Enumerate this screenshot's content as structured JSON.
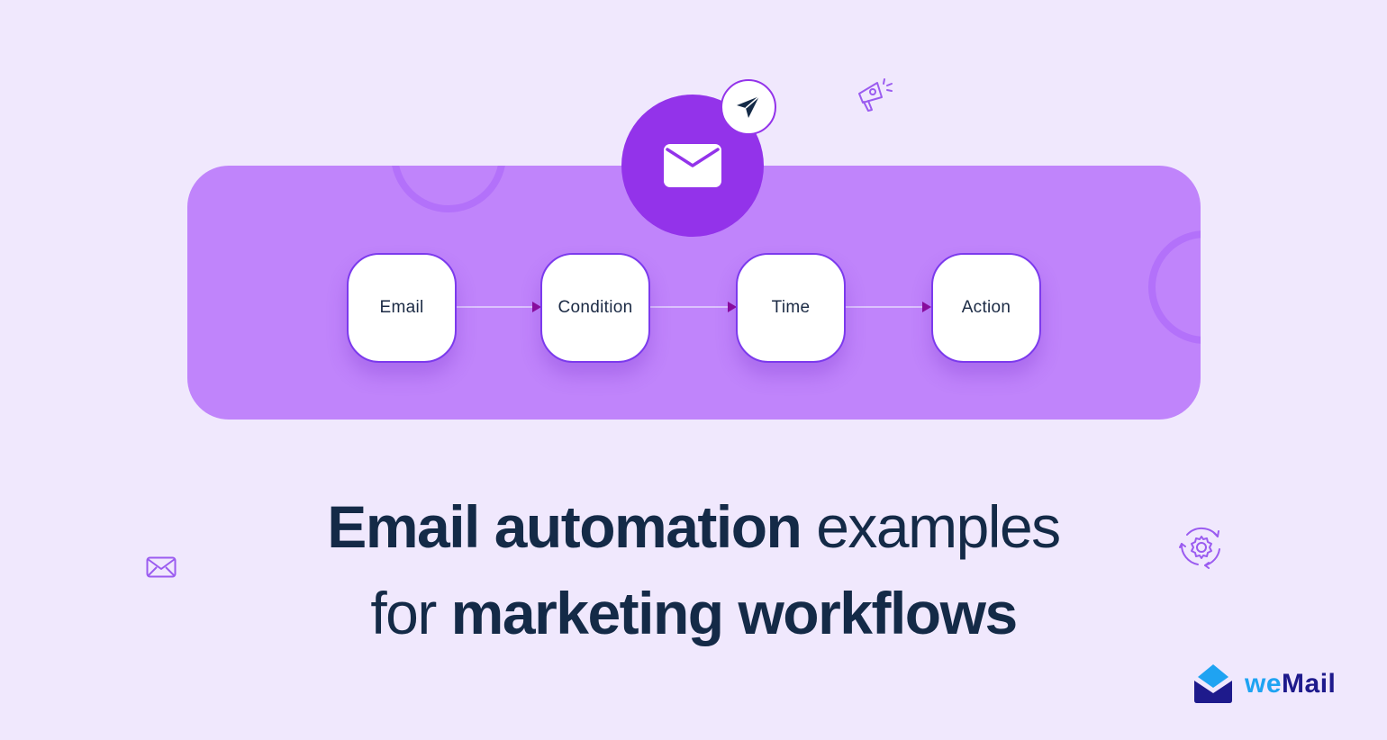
{
  "workflow": {
    "nodes": [
      {
        "label": "Email"
      },
      {
        "label": "Condition"
      },
      {
        "label": "Time"
      },
      {
        "label": "Action"
      }
    ]
  },
  "headline": {
    "line1_bold": "Email automation",
    "line1_light": " examples",
    "line2_light": "for ",
    "line2_bold": "marketing workflows"
  },
  "brand": {
    "name_part1": "we",
    "name_part2": "Mail"
  },
  "colors": {
    "background": "#f0e8fd",
    "panel": "#c084fb",
    "hub": "#9333ea",
    "text_dark": "#142a47",
    "brand_light_blue": "#1fa3f2",
    "brand_navy": "#1e1a8c"
  },
  "icons": [
    "envelope-icon",
    "paper-plane-icon",
    "megaphone-icon",
    "gear-cycle-icon",
    "small-envelope-icon",
    "wemail-logo-icon"
  ]
}
